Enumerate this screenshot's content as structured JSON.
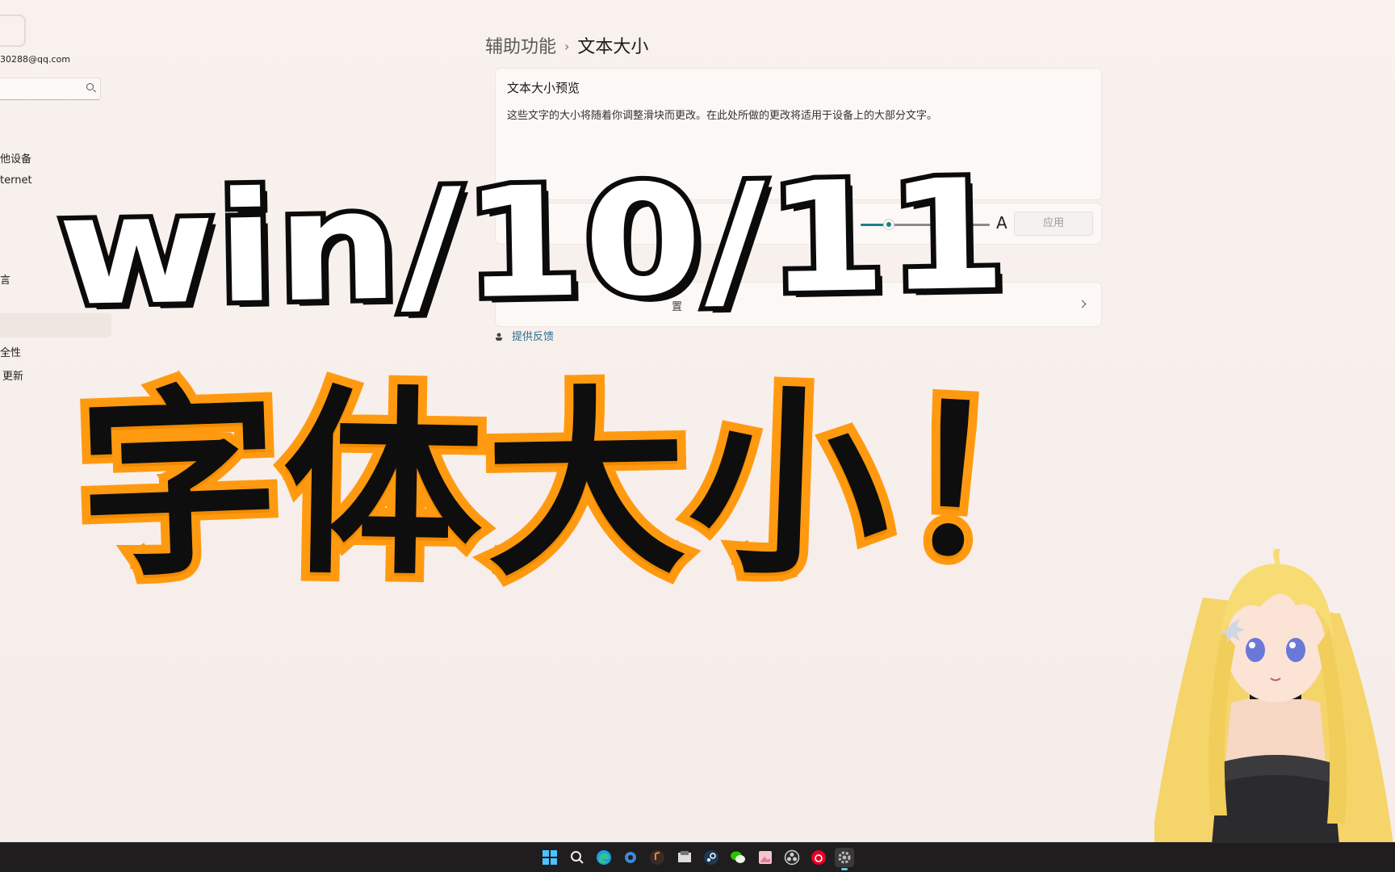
{
  "sidebar": {
    "email": "30288@qq.com",
    "items": [
      {
        "label": "他设备"
      },
      {
        "label": "ternet"
      },
      {
        "label": "言"
      },
      {
        "label": "全性"
      },
      {
        "label": "更新"
      }
    ]
  },
  "breadcrumb": {
    "parent": "辅助功能",
    "separator": "›",
    "current": "文本大小"
  },
  "preview": {
    "title": "文本大小预览",
    "text": "这些文字的大小将随着你调整滑块而更改。在此处所做的更改将适用于设备上的大部分文字。"
  },
  "slider": {
    "small_label": "A",
    "large_label": "A",
    "value_fraction": 0.21,
    "accent": "#1d7f8c",
    "apply_label": "应用"
  },
  "related": {
    "label": "置"
  },
  "feedback": {
    "label": "提供反馈"
  },
  "overlay": {
    "title": "win/10/11",
    "headline_chars": [
      "字",
      "体",
      "大",
      "小",
      "！"
    ],
    "headline_fill": "#0e0e0e",
    "headline_stroke": "#ff9a10"
  },
  "taskbar": {
    "icons": [
      "windows-start-icon",
      "search-icon",
      "edge-browser-icon",
      "settings-gear-app-icon",
      "music-app-icon",
      "file-manager-icon",
      "steam-icon",
      "wechat-icon",
      "image-viewer-icon",
      "obs-icon",
      "netease-music-icon",
      "settings-icon"
    ]
  }
}
